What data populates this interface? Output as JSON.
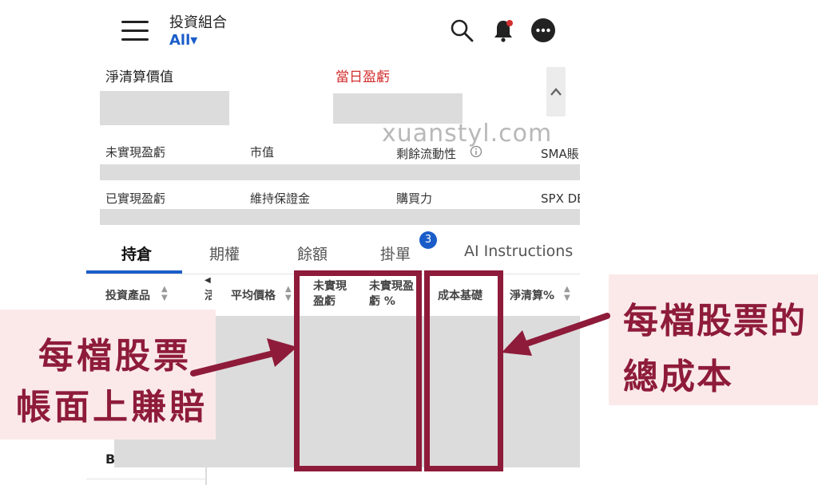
{
  "header": {
    "portfolio_title": "投資組合",
    "portfolio_filter": "All▾",
    "icons": [
      "menu-icon",
      "search-icon",
      "bell-icon",
      "more-icon"
    ]
  },
  "summary": {
    "net_liquidation_label": "淨清算價值",
    "daily_pnl_label": "當日盈虧",
    "unrealized_pnl_label": "未實現盈虧",
    "market_value_label": "市值",
    "excess_liquidity_label": "剩餘流動性",
    "sma_label": "SMA賬",
    "realized_pnl_label": "已實現盈虧",
    "maintenance_margin_label": "維持保證金",
    "buying_power_label": "購買力",
    "spx_label": "SPX DE"
  },
  "watermark": "xuanstyl.com",
  "tabs": [
    {
      "label": "持倉",
      "active": true
    },
    {
      "label": "期權"
    },
    {
      "label": "餘額"
    },
    {
      "label": "掛單",
      "badge": "3"
    },
    {
      "label": "AI Instructions"
    }
  ],
  "table": {
    "columns": [
      "投資產品",
      "活",
      "平均價格",
      "未實現\n盈虧",
      "未實現盈\n虧 %",
      "成本基礎",
      "淨清算%"
    ],
    "row_stub": "B"
  },
  "annotations": {
    "left_callout": [
      "每檔股票",
      "帳面上賺賠"
    ],
    "right_callout": [
      "每檔股票的",
      "總成本"
    ]
  },
  "colors": {
    "accent": "#1a5dc8",
    "highlight": "#8e1b3a",
    "callout_bg": "#fbe9ea",
    "loss_red": "#d32f2f"
  }
}
